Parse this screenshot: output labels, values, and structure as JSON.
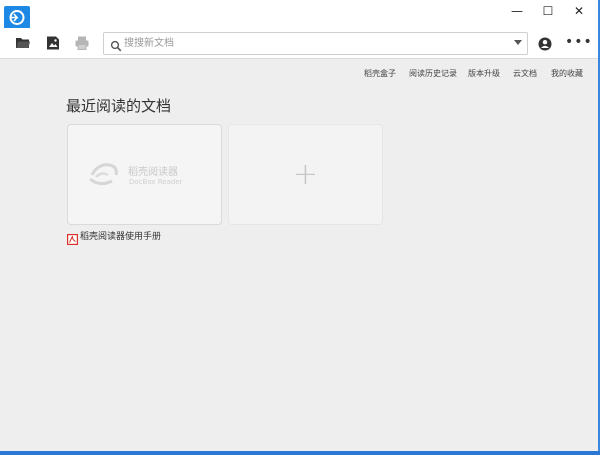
{
  "window": {
    "minimize_glyph": "—",
    "maximize_glyph": "☐",
    "close_glyph": "✕"
  },
  "toolbar": {
    "icons": [
      "open-folder-icon",
      "save-image-icon",
      "print-icon"
    ],
    "search_placeholder": "搜搜新文档",
    "search_value": "",
    "more_label": "•••"
  },
  "top_nav": {
    "items": [
      "稻壳盒子",
      "阅读历史记录",
      "版本升级",
      "云文档",
      "我的收藏"
    ]
  },
  "recent": {
    "title": "最近阅读的文档",
    "documents": [
      {
        "cover_brand": "稻壳阅读器",
        "cover_sub": "DocBox Reader",
        "name": "稻壳阅读器使用手册"
      }
    ],
    "add_label": "+"
  },
  "colors": {
    "accent": "#1e88e5",
    "background": "#eeeeee",
    "pdf_red": "#d9302b"
  }
}
